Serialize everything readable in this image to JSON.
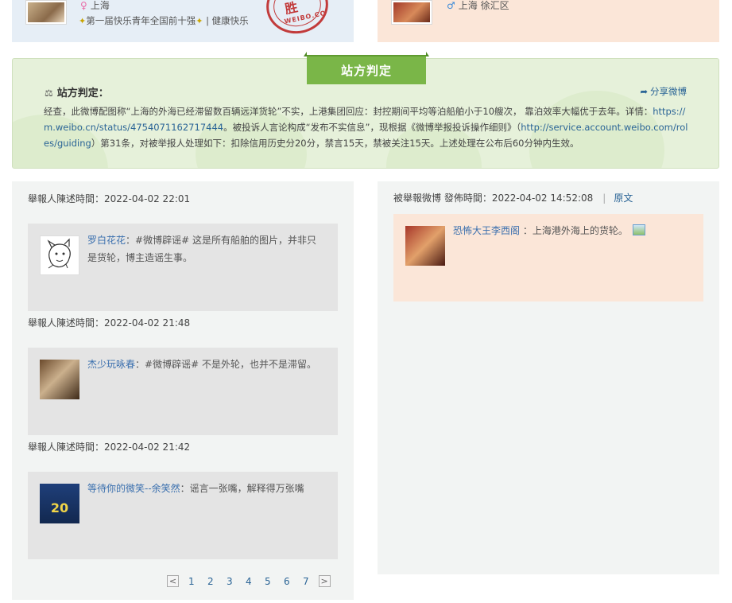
{
  "top": {
    "reporter_location": "上海",
    "reporter_honor": "第一届快乐青年全国前十强",
    "reporter_honor_tail": "健康快乐",
    "stamp_word": "胜",
    "stamp_text": "WEIBO.COM",
    "reported_location": "上海 徐汇区"
  },
  "judgement": {
    "tab_label": "站方判定",
    "title": "站方判定：",
    "share_label": "分享微博",
    "body_lead": "经查，此微博配图称“上海的外海已经滞留数百辆远洋货轮”不实，上港集团回应：封控期间平均等泊船舶小于10艘次， 靠泊效率大幅优于去年。详情：",
    "body_link1": "https://m.weibo.cn/status/4754071162717444",
    "body_mid": "。被投诉人言论构成“发布不实信息”，现根据《微博举报投诉操作细则》（",
    "body_link2": "http://service.account.weibo.com/roles/guiding",
    "body_tail": "）第31条，对被举报人处理如下：扣除信用历史分20分，禁言15天，禁被关注15天。上述处理在公布后60分钟内生效。"
  },
  "reports": [
    {
      "time": "舉報人陳述時間：2022-04-02 22:01",
      "user": "罗白花花",
      "content": "：#微博辟谣# 这是所有船舶的图片，并非只是货轮，博主造谣生事。"
    },
    {
      "time": "舉報人陳述時間：2022-04-02 21:48",
      "user": "杰少玩咏春",
      "content": "：#微博辟谣# 不是外轮，也并不是滞留。"
    },
    {
      "time": "舉報人陳述時間：2022-04-02 21:42",
      "user": "等待你的微笑--余笑然",
      "content": "：谣言一张嘴，解释得万张嘴",
      "avatar_text": "20"
    }
  ],
  "reported": {
    "time": "被舉報微博 發佈時間：2022-04-02 14:52:08",
    "original_label": "原文",
    "user": "恐怖大王李西阁",
    "content": " ：上海港外海上的货轮。"
  },
  "pager": {
    "prev": "<",
    "next": ">",
    "pages": [
      "1",
      "2",
      "3",
      "4",
      "5",
      "6",
      "7"
    ]
  },
  "icons": {
    "female": "female-icon",
    "male": "male-icon",
    "gavel": "gavel-icon",
    "share": "share-arrow-icon",
    "picture": "picture-icon"
  },
  "colors": {
    "link": "#2a6496",
    "judge_tab": "#7ab648",
    "judge_bg": "#e6f1da",
    "reported_bg": "#fbe6d8",
    "reporter_bg": "#e6eef6"
  }
}
